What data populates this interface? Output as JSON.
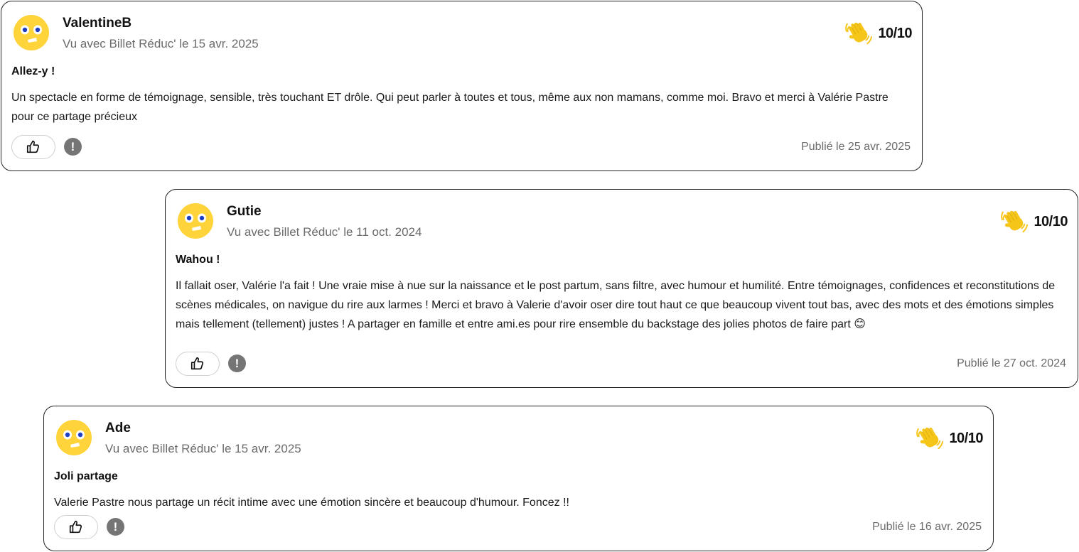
{
  "colors": {
    "avatar_face": "#ffd43b",
    "avatar_eyes": "#1c3fc4",
    "hand_emoji": "#f5c518",
    "report_badge": "#757575",
    "muted_text": "#6b6b6b"
  },
  "icons": {
    "avatar": "smiley-face-icon",
    "rating": "waving-hand-icon",
    "like": "thumbs-up-icon",
    "report": "exclamation-icon",
    "inline_emoji": "smiling-face-emoji"
  },
  "reviews": [
    {
      "name": "ValentineB",
      "seen_with": "Vu avec Billet Réduc' le 15 avr. 2025",
      "score": "10/10",
      "title": "Allez-y !",
      "body": "Un spectacle en forme de témoignage, sensible, très touchant ET drôle. Qui peut parler à toutes et tous, même aux non mamans, comme moi. Bravo et merci à Valérie Pastre pour ce partage précieux",
      "published": "Publié le 25 avr. 2025",
      "report_label": "!"
    },
    {
      "name": "Gutie",
      "seen_with": "Vu avec Billet Réduc' le 11 oct. 2024",
      "score": "10/10",
      "title": "Wahou !",
      "body": "Il fallait oser, Valérie l'a fait ! Une vraie mise à nue sur la naissance et le post partum, sans filtre, avec humour et humilité. Entre témoignages, confidences et reconstitutions de scènes médicales, on navigue du rire aux larmes ! Merci et bravo à Valerie d'avoir oser dire tout haut ce que beaucoup vivent tout bas, avec des mots et des émotions simples mais tellement (tellement) justes ! A partager en famille et entre ami.es pour rire ensemble du backstage des jolies photos de faire part 😊",
      "published": "Publié le 27 oct. 2024",
      "report_label": "!"
    },
    {
      "name": "Ade",
      "seen_with": "Vu avec Billet Réduc' le 15 avr. 2025",
      "score": "10/10",
      "title": "Joli partage",
      "body": "Valerie Pastre nous partage un récit intime avec une émotion sincère et beaucoup d'humour. Foncez !!",
      "published": "Publié le 16 avr. 2025",
      "report_label": "!"
    }
  ]
}
